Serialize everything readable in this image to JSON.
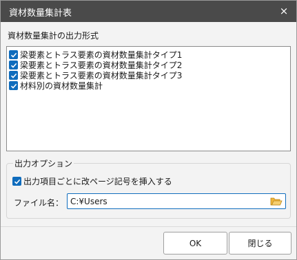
{
  "window": {
    "title": "資材数量集計表",
    "close_icon": "×"
  },
  "output_format": {
    "label": "資材数量集計の出力形式",
    "items": [
      {
        "label": "梁要素とトラス要素の資材数量集計タイプ1",
        "checked": true
      },
      {
        "label": "梁要素とトラス要素の資材数量集計タイプ2",
        "checked": true
      },
      {
        "label": "梁要素とトラス要素の資材数量集計タイプ3",
        "checked": true
      },
      {
        "label": "材料別の資材数量集計",
        "checked": true
      }
    ]
  },
  "output_options": {
    "legend": "出力オプション",
    "page_break": {
      "label": "出力項目ごとに改ページ記号を挿入する",
      "checked": true
    },
    "file_name": {
      "label": "ファイル名：",
      "value": "C:¥Users",
      "browse_icon": "folder-open-icon"
    }
  },
  "footer": {
    "ok_label": "OK",
    "close_label": "閉じる"
  },
  "colors": {
    "accent": "#0f6cbd",
    "titlebar": "#4a4a4a",
    "dialog_bg": "#f3f3f3",
    "folder": "#e8a317"
  }
}
